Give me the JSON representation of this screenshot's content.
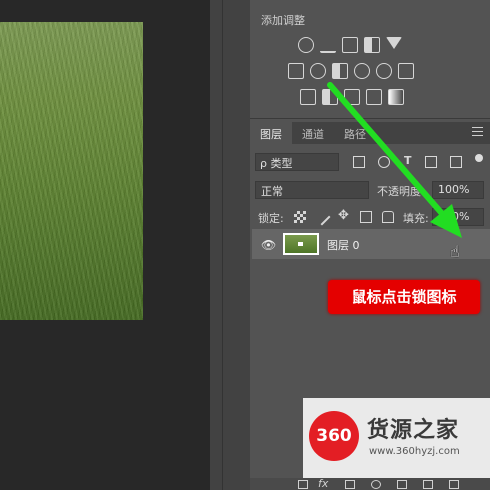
{
  "adjustments": {
    "title": "添加调整",
    "icons_row1": [
      "brightness-icon",
      "levels-icon",
      "curves-icon",
      "exposure-icon",
      "vibrance-icon"
    ],
    "icons_row2": [
      "hue-saturation-icon",
      "color-balance-icon",
      "black-white-icon",
      "photo-filter-icon",
      "channel-mixer-icon",
      "color-lookup-icon"
    ],
    "icons_row3": [
      "invert-icon",
      "posterize-icon",
      "threshold-icon",
      "selective-color-icon",
      "gradient-map-icon"
    ]
  },
  "tabs": [
    {
      "label": "图层",
      "active": true
    },
    {
      "label": "通道",
      "active": false
    },
    {
      "label": "路径",
      "active": false
    }
  ],
  "filter": {
    "label": "ρ 类型"
  },
  "blend": {
    "mode": "正常",
    "opacity_label": "不透明度:",
    "opacity_value": "100%"
  },
  "lock": {
    "label": "锁定:",
    "fill_label": "填充:",
    "fill_value": "100%"
  },
  "layer": {
    "name": "图层 0"
  },
  "callout": {
    "text": "鼠标点击锁图标"
  },
  "watermark": {
    "badge": "360",
    "title": "货源之家",
    "url": "www.360hyzj.com"
  },
  "colors": {
    "callout": "#e40000",
    "arrow": "#22dd22",
    "panel": "#535353"
  }
}
